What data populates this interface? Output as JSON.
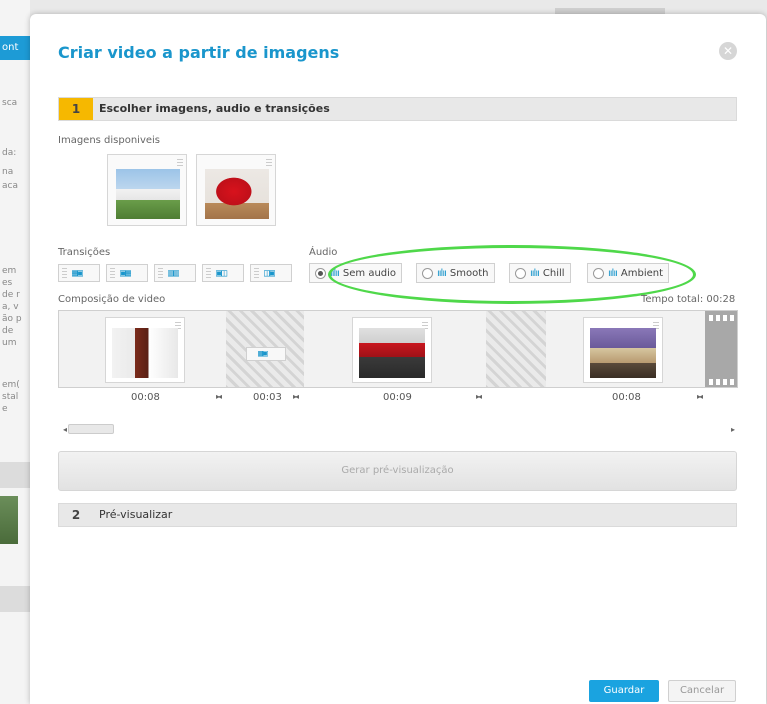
{
  "background": {
    "tab_fragment": "ont",
    "fragments": [
      "sca",
      "da:",
      "na",
      "aca",
      "em",
      "es",
      "de r",
      "a, v",
      "ão p",
      "de",
      "um",
      "em(",
      "stal",
      "e"
    ]
  },
  "modal": {
    "title": "Criar video a partir de imagens",
    "close_icon": "close-icon"
  },
  "step1": {
    "number": "1",
    "label": "Escolher imagens, audio e transições"
  },
  "available_images": {
    "label": "Imagens disponiveis",
    "items": [
      {
        "name": "house-photo"
      },
      {
        "name": "red-chair-photo"
      }
    ]
  },
  "transitions": {
    "label": "Transições",
    "items": [
      {
        "glyph": "▦▣"
      },
      {
        "glyph": "▣▦"
      },
      {
        "glyph": "▥▥"
      },
      {
        "glyph": "▣◫"
      },
      {
        "glyph": "◫▣"
      }
    ]
  },
  "audio": {
    "label": "Áudio",
    "wave_glyph": "ıılıı",
    "options": [
      {
        "label": "Sem audio",
        "selected": true
      },
      {
        "label": "Smooth",
        "selected": false
      },
      {
        "label": "Chill",
        "selected": false
      },
      {
        "label": "Ambient",
        "selected": false
      }
    ]
  },
  "composition": {
    "label": "Composição de video",
    "total_time": "Tempo total: 00:28",
    "durations": [
      "00:08",
      "00:03",
      "00:09",
      "00:08"
    ],
    "clip_transition_glyph": "▦▣",
    "separator_glyph": "▸◂"
  },
  "scrollbar": {
    "left_arrow": "◂",
    "right_arrow": "▸"
  },
  "preview_button": "Gerar pré-visualização",
  "step2": {
    "number": "2",
    "label": "Pré-visualizar"
  },
  "actions": {
    "save": "Guardar",
    "cancel": "Cancelar"
  },
  "colors": {
    "accent": "#1a96cc",
    "step_active": "#f6b800",
    "annotation": "#4fd84a",
    "save": "#1aa3e0"
  }
}
